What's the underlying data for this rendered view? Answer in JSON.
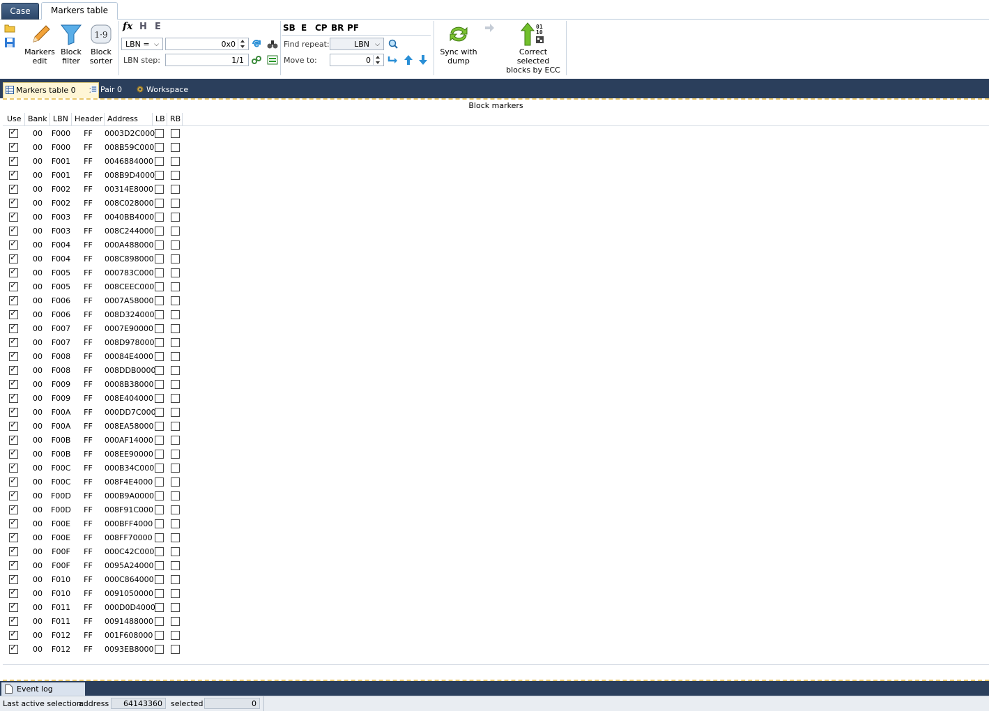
{
  "top_tabs": [
    "Case",
    "Markers table"
  ],
  "ribbon": {
    "markers_edit": "Markers\nedit",
    "block_filter": "Block\nfilter",
    "block_sorter": "Block\nsorter",
    "lbn_select": "LBN =",
    "value_field": "0x0",
    "lbn_step_label": "LBN step:",
    "lbn_step_value": "1/1",
    "flags": [
      "SB",
      "E",
      "CP",
      "BR",
      "PF"
    ],
    "find_repeat_label": "Find repeat:",
    "find_repeat_value": "LBN",
    "move_to_label": "Move to:",
    "move_to_value": "0",
    "sync_with_dump": "Sync with\ndump",
    "correct_ecc": "Correct selected\nblocks by ECC",
    "ecc_bits": "01\n10"
  },
  "doc_tabs": [
    {
      "label": "Markers table 0",
      "closable": true
    },
    {
      "label": "Pair 0",
      "closable": false
    },
    {
      "label": "Workspace",
      "closable": false
    }
  ],
  "section_title": "Block markers",
  "columns": [
    "Use",
    "Bank",
    "LBN",
    "Header",
    "Address",
    "LB",
    "RB"
  ],
  "rows": [
    [
      "00",
      "F000",
      "FF",
      "0003D2C000"
    ],
    [
      "00",
      "F000",
      "FF",
      "008B59C000"
    ],
    [
      "00",
      "F001",
      "FF",
      "0046884000"
    ],
    [
      "00",
      "F001",
      "FF",
      "008B9D4000"
    ],
    [
      "00",
      "F002",
      "FF",
      "00314E8000"
    ],
    [
      "00",
      "F002",
      "FF",
      "008C028000"
    ],
    [
      "00",
      "F003",
      "FF",
      "0040BB4000"
    ],
    [
      "00",
      "F003",
      "FF",
      "008C244000"
    ],
    [
      "00",
      "F004",
      "FF",
      "000A488000"
    ],
    [
      "00",
      "F004",
      "FF",
      "008C898000"
    ],
    [
      "00",
      "F005",
      "FF",
      "000783C000"
    ],
    [
      "00",
      "F005",
      "FF",
      "008CEEC000"
    ],
    [
      "00",
      "F006",
      "FF",
      "0007A58000"
    ],
    [
      "00",
      "F006",
      "FF",
      "008D324000"
    ],
    [
      "00",
      "F007",
      "FF",
      "0007E90000"
    ],
    [
      "00",
      "F007",
      "FF",
      "008D978000"
    ],
    [
      "00",
      "F008",
      "FF",
      "00084E4000"
    ],
    [
      "00",
      "F008",
      "FF",
      "008DDB0000"
    ],
    [
      "00",
      "F009",
      "FF",
      "0008B38000"
    ],
    [
      "00",
      "F009",
      "FF",
      "008E404000"
    ],
    [
      "00",
      "F00A",
      "FF",
      "000DD7C000"
    ],
    [
      "00",
      "F00A",
      "FF",
      "008EA58000"
    ],
    [
      "00",
      "F00B",
      "FF",
      "000AF14000"
    ],
    [
      "00",
      "F00B",
      "FF",
      "008EE90000"
    ],
    [
      "00",
      "F00C",
      "FF",
      "000B34C000"
    ],
    [
      "00",
      "F00C",
      "FF",
      "008F4E4000"
    ],
    [
      "00",
      "F00D",
      "FF",
      "000B9A0000"
    ],
    [
      "00",
      "F00D",
      "FF",
      "008F91C000"
    ],
    [
      "00",
      "F00E",
      "FF",
      "000BFF4000"
    ],
    [
      "00",
      "F00E",
      "FF",
      "008FF70000"
    ],
    [
      "00",
      "F00F",
      "FF",
      "000C42C000"
    ],
    [
      "00",
      "F00F",
      "FF",
      "0095A24000"
    ],
    [
      "00",
      "F010",
      "FF",
      "000C864000"
    ],
    [
      "00",
      "F010",
      "FF",
      "0091050000"
    ],
    [
      "00",
      "F011",
      "FF",
      "000D0D4000"
    ],
    [
      "00",
      "F011",
      "FF",
      "0091488000"
    ],
    [
      "00",
      "F012",
      "FF",
      "001F608000"
    ],
    [
      "00",
      "F012",
      "FF",
      "0093EB8000"
    ]
  ],
  "bottom_tab": "Event log explorer",
  "status": {
    "label": "Last active selection:",
    "address_label": "address",
    "address_value": "64143360",
    "selected_label": "selected",
    "selected_value": "0"
  },
  "colors": {
    "dark_strip": "#2b3f5c",
    "accent_dashed": "#e8c66a",
    "active_tab": "#fff6d6"
  }
}
